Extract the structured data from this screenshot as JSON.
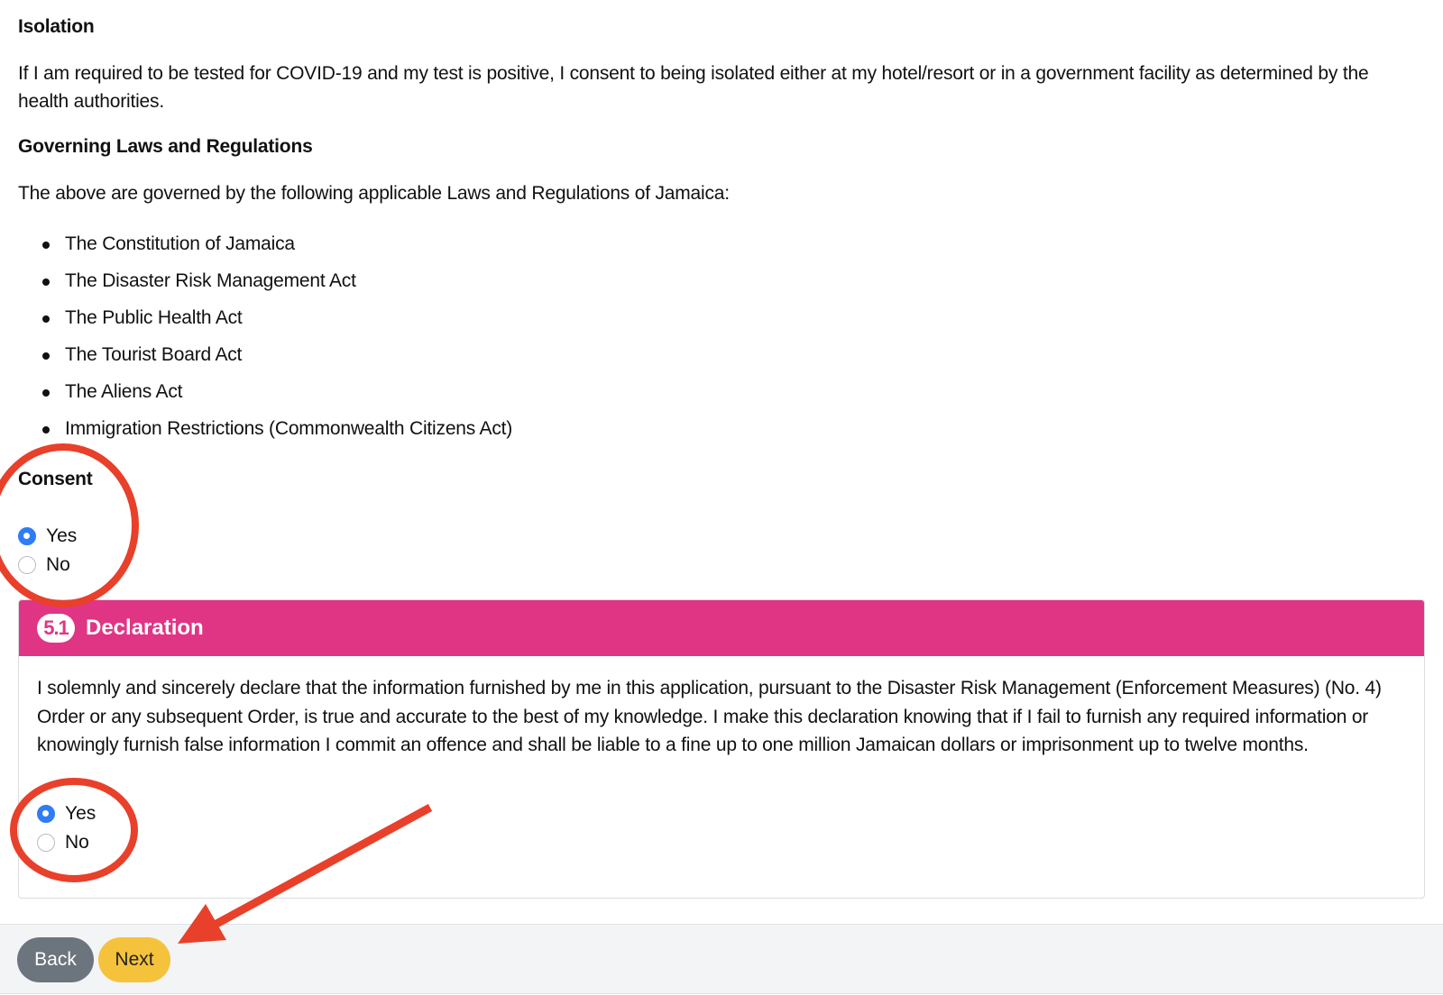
{
  "isolation": {
    "heading": "Isolation",
    "text": "If I am required to be tested for COVID-19 and my test is positive, I consent to being isolated either at my hotel/resort or in a government facility as determined by the health authorities."
  },
  "governing_laws": {
    "heading": "Governing Laws and Regulations",
    "intro": "The above are governed by the following applicable Laws and Regulations of Jamaica:",
    "items": [
      "The Constitution of Jamaica",
      "The Disaster Risk Management Act",
      "The Public Health Act",
      "The Tourist Board Act",
      "The Aliens Act",
      "Immigration Restrictions (Commonwealth Citizens Act)"
    ]
  },
  "consent": {
    "heading": "Consent",
    "options": [
      {
        "label": "Yes",
        "checked": true
      },
      {
        "label": "No",
        "checked": false
      }
    ]
  },
  "declaration": {
    "badge": "5.1",
    "title": "Declaration",
    "text": "I solemnly and sincerely declare that the information furnished by me in this application, pursuant to the Disaster Risk Management (Enforcement Measures) (No. 4) Order or any subsequent Order, is true and accurate to the best of my knowledge. I make this declaration knowing that if I fail to furnish any required information or knowingly furnish false information I commit an offence and shall be liable to a fine up to one million Jamaican dollars or imprisonment up to twelve months.",
    "options": [
      {
        "label": "Yes",
        "checked": true
      },
      {
        "label": "No",
        "checked": false
      }
    ]
  },
  "footer": {
    "back_label": "Back",
    "next_label": "Next"
  },
  "colors": {
    "header_accent": "#e03585",
    "radio_checked": "#2f7cf6",
    "next_button": "#f5c23c",
    "back_button": "#6c757d",
    "annotation": "#e8402a"
  }
}
